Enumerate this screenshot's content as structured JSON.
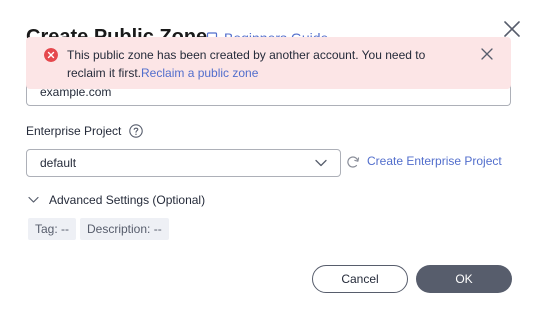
{
  "dialog": {
    "title": "Create Public Zone",
    "guide_link": "Beginners Guide"
  },
  "alert": {
    "message": "This public zone has been created by another account. You need to reclaim it first.",
    "link": "Reclaim a public zone"
  },
  "zone_name": {
    "value": "example.com"
  },
  "enterprise_project": {
    "label": "Enterprise Project",
    "selected": "default",
    "create_link": "Create Enterprise Project"
  },
  "advanced": {
    "label": "Advanced Settings (Optional)",
    "tag": "Tag: --",
    "description": "Description: --"
  },
  "buttons": {
    "cancel": "Cancel",
    "ok": "OK"
  },
  "colors": {
    "error": "#e5484d",
    "alert_bg": "#fce5e6",
    "link": "#526ecc",
    "primary_button": "#575d6c"
  },
  "icons": [
    "close-icon",
    "error-icon",
    "help-icon",
    "chevron-down-icon",
    "refresh-icon",
    "chevron-right-icon",
    "book-icon"
  ]
}
